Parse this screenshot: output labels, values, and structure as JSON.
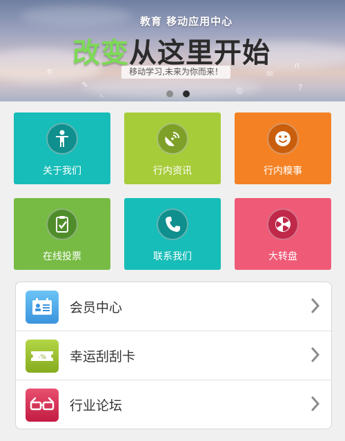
{
  "banner": {
    "subtitle": "教育 移动应用中心",
    "title_green": "改变",
    "title_dark": "从这里开始",
    "slogan": "移动学习,未来为你而来！",
    "slide_count": 2,
    "active_slide": 2
  },
  "tiles": [
    {
      "label": "关于我们",
      "color": "#17bdb8",
      "circle": "#0f8f8e",
      "icon": "person-icon"
    },
    {
      "label": "行内资讯",
      "color": "#a7cc3a",
      "circle": "#7ea028",
      "icon": "satellite-dish-icon"
    },
    {
      "label": "行内糗事",
      "color": "#f48224",
      "circle": "#c95e0d",
      "icon": "smiley-icon"
    },
    {
      "label": "在线投票",
      "color": "#77bb44",
      "circle": "#4f8d2b",
      "icon": "clipboard-check-icon"
    },
    {
      "label": "联系我们",
      "color": "#17bdb8",
      "circle": "#0f8f8e",
      "icon": "phone-icon"
    },
    {
      "label": "大转盘",
      "color": "#ef5a77",
      "circle": "#c0284a",
      "icon": "wheel-icon"
    }
  ],
  "menu": [
    {
      "label": "会员中心",
      "icon": "member-card-icon",
      "color": "#4aa7e8"
    },
    {
      "label": "幸运刮刮卡",
      "icon": "scratch-card-icon",
      "color": "#9cc22c",
      "icon_text": "-%"
    },
    {
      "label": "行业论坛",
      "icon": "glasses-icon",
      "color": "#d8284f"
    }
  ]
}
